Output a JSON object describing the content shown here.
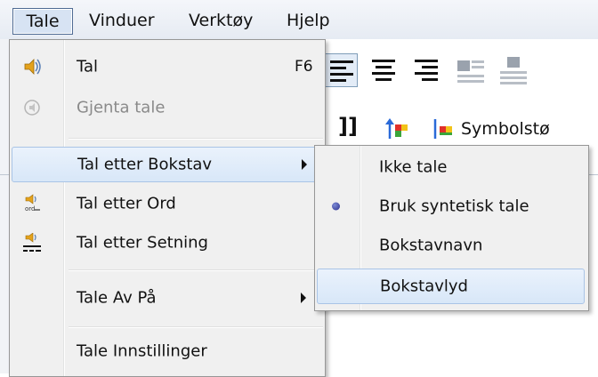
{
  "menubar": {
    "items": [
      {
        "label": "Tale",
        "active": true
      },
      {
        "label": "Vinduer"
      },
      {
        "label": "Verktøy"
      },
      {
        "label": "Hjelp"
      }
    ]
  },
  "toolbar": {
    "symbol_label": "Symbolstø",
    "bracket_glyph": "]]"
  },
  "tale_menu": {
    "items": [
      {
        "label": "Tal",
        "shortcut": "F6",
        "icon": "speaker-icon"
      },
      {
        "label": "Gjenta tale",
        "disabled": true,
        "icon": "repeat-speech-icon"
      },
      {
        "label": "Tal etter Bokstav",
        "submenu": true,
        "highlighted": true
      },
      {
        "label": "Tal etter Ord",
        "icon": "speak-word-icon"
      },
      {
        "label": "Tal etter Setning",
        "icon": "speak-sentence-icon"
      },
      {
        "label": "Tale Av På",
        "submenu": true
      },
      {
        "label": "Tale Innstillinger"
      }
    ]
  },
  "letter_submenu": {
    "items": [
      {
        "label": "Ikke tale"
      },
      {
        "label": "Bruk syntetisk tale",
        "checked": true
      },
      {
        "label": "Bokstavnavn"
      },
      {
        "label": "Bokstavlyd",
        "highlighted": true
      }
    ]
  },
  "colors": {
    "highlight": "#d8e7f8",
    "menu_bg": "#f0f0f0",
    "radio": "#2b2f8c"
  }
}
